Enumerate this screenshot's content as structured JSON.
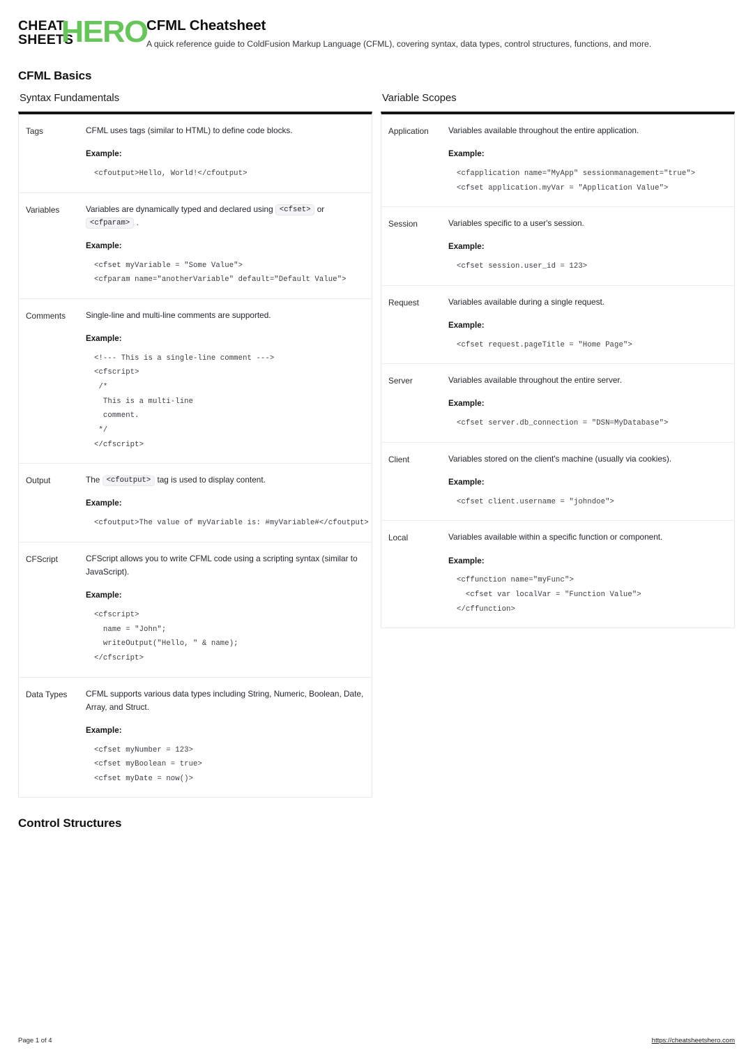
{
  "brand": {
    "logo_line1": "CHEAT",
    "logo_line2": "SHEETS",
    "logo_accent": "HERO",
    "accent_color": "#66c65a"
  },
  "header": {
    "title": "CFML Cheatsheet",
    "subtitle": "A quick reference guide to ColdFusion Markup Language (CFML), covering syntax, data types, control structures, functions, and more."
  },
  "sections": [
    {
      "heading": "CFML Basics",
      "subsections": [
        {
          "title": "Syntax Fundamentals",
          "rows": [
            {
              "term": "Tags",
              "desc_parts": [
                {
                  "type": "text",
                  "value": "CFML uses tags (similar to HTML) to define code blocks."
                }
              ],
              "example_label": "Example:",
              "code": "<cfoutput>Hello, World!</cfoutput>"
            },
            {
              "term": "Variables",
              "desc_parts": [
                {
                  "type": "text",
                  "value": "Variables are dynamically typed and declared using "
                },
                {
                  "type": "code",
                  "value": "<cfset>"
                },
                {
                  "type": "text",
                  "value": " or "
                },
                {
                  "type": "code",
                  "value": "<cfparam>"
                },
                {
                  "type": "text",
                  "value": " ."
                }
              ],
              "example_label": "Example:",
              "code": "<cfset myVariable = \"Some Value\">\n<cfparam name=\"anotherVariable\" default=\"Default Value\">"
            },
            {
              "term": "Comments",
              "desc_parts": [
                {
                  "type": "text",
                  "value": "Single-line and multi-line comments are supported."
                }
              ],
              "example_label": "Example:",
              "code": "<!--- This is a single-line comment --->\n<cfscript>\n /*\n  This is a multi-line\n  comment.\n */\n</cfscript>"
            },
            {
              "term": "Output",
              "desc_parts": [
                {
                  "type": "text",
                  "value": "The "
                },
                {
                  "type": "code",
                  "value": "<cfoutput>"
                },
                {
                  "type": "text",
                  "value": " tag is used to display content."
                }
              ],
              "example_label": "Example:",
              "code": "<cfoutput>The value of myVariable is: #myVariable#</cfoutput>"
            },
            {
              "term": "CFScript",
              "desc_parts": [
                {
                  "type": "text",
                  "value": "CFScript allows you to write CFML code using a scripting syntax (similar to JavaScript)."
                }
              ],
              "example_label": "Example:",
              "code": "<cfscript>\n  name = \"John\";\n  writeOutput(\"Hello, \" & name);\n</cfscript>"
            },
            {
              "term": "Data Types",
              "desc_parts": [
                {
                  "type": "text",
                  "value": "CFML supports various data types including String, Numeric, Boolean, Date, Array, and Struct."
                }
              ],
              "example_label": "Example:",
              "code": "<cfset myNumber = 123>\n<cfset myBoolean = true>\n<cfset myDate = now()>"
            }
          ]
        },
        {
          "title": "Variable Scopes",
          "rows": [
            {
              "term": "Application",
              "desc_parts": [
                {
                  "type": "text",
                  "value": "Variables available throughout the entire application."
                }
              ],
              "example_label": "Example:",
              "code": "<cfapplication name=\"MyApp\" sessionmanagement=\"true\">\n<cfset application.myVar = \"Application Value\">"
            },
            {
              "term": "Session",
              "desc_parts": [
                {
                  "type": "text",
                  "value": "Variables specific to a user's session."
                }
              ],
              "example_label": "Example:",
              "code": "<cfset session.user_id = 123>"
            },
            {
              "term": "Request",
              "desc_parts": [
                {
                  "type": "text",
                  "value": "Variables available during a single request."
                }
              ],
              "example_label": "Example:",
              "code": "<cfset request.pageTitle = \"Home Page\">"
            },
            {
              "term": "Server",
              "desc_parts": [
                {
                  "type": "text",
                  "value": "Variables available throughout the entire server."
                }
              ],
              "example_label": "Example:",
              "code": "<cfset server.db_connection = \"DSN=MyDatabase\">"
            },
            {
              "term": "Client",
              "desc_parts": [
                {
                  "type": "text",
                  "value": "Variables stored on the client's machine (usually via cookies)."
                }
              ],
              "example_label": "Example:",
              "code": "<cfset client.username = \"johndoe\">"
            },
            {
              "term": "Local",
              "desc_parts": [
                {
                  "type": "text",
                  "value": "Variables available within a specific function or component."
                }
              ],
              "example_label": "Example:",
              "code": "<cffunction name=\"myFunc\">\n  <cfset var localVar = \"Function Value\">\n</cffunction>"
            }
          ]
        }
      ]
    },
    {
      "heading": "Control Structures",
      "subsections": []
    }
  ],
  "footer": {
    "page_label": "Page 1 of 4",
    "site_url": "https://cheatsheetshero.com"
  }
}
